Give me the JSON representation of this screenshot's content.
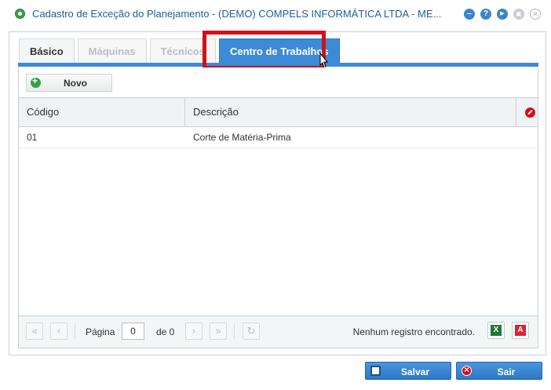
{
  "window": {
    "title": "Cadastro de Exceção do Planejamento - (DEMO) COMPELS INFORMÁTICA LTDA - ME...",
    "title_icon": "app-icon",
    "controls": [
      {
        "name": "collapse-icon",
        "glyph": "–"
      },
      {
        "name": "help-icon",
        "glyph": "?"
      },
      {
        "name": "next-icon",
        "glyph": "▶"
      },
      {
        "name": "print-icon",
        "glyph": "▣"
      },
      {
        "name": "close-icon",
        "glyph": "✕"
      }
    ]
  },
  "tabs": [
    {
      "label": "Básico",
      "state": "normal"
    },
    {
      "label": "Máquinas",
      "state": "disabled"
    },
    {
      "label": "Técnicos",
      "state": "disabled"
    },
    {
      "label": "Centro de Trabalhos",
      "state": "active"
    }
  ],
  "toolbar": {
    "new_label": "Novo"
  },
  "grid": {
    "columns": [
      "Código",
      "Descrição"
    ],
    "rows": [
      {
        "codigo": "01",
        "descricao": "Corte de Matéria-Prima"
      }
    ]
  },
  "pager": {
    "page_label": "Página",
    "page_value": "0",
    "of_label": "de 0",
    "status": "Nenhum registro encontrado."
  },
  "footer": {
    "save_label": "Salvar",
    "exit_label": "Sair"
  },
  "colors": {
    "accent": "#3d8ad6",
    "highlight": "#d1111a",
    "title": "#1c5e97"
  }
}
